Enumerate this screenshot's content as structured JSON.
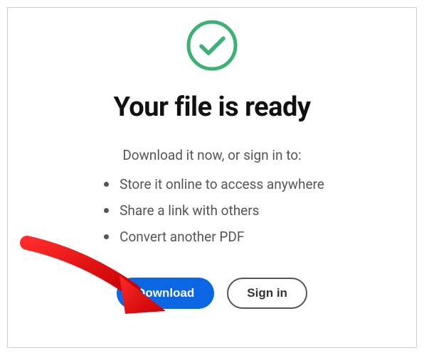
{
  "title": "Your file is ready",
  "subtitle": "Download it now, or sign in to:",
  "bullets": [
    "Store it online to access anywhere",
    "Share a link with others",
    "Convert another PDF"
  ],
  "buttons": {
    "primary": "Download",
    "secondary": "Sign in"
  },
  "colors": {
    "success": "#3BB273",
    "primary": "#0b66e4",
    "annotation": "#E30000"
  }
}
